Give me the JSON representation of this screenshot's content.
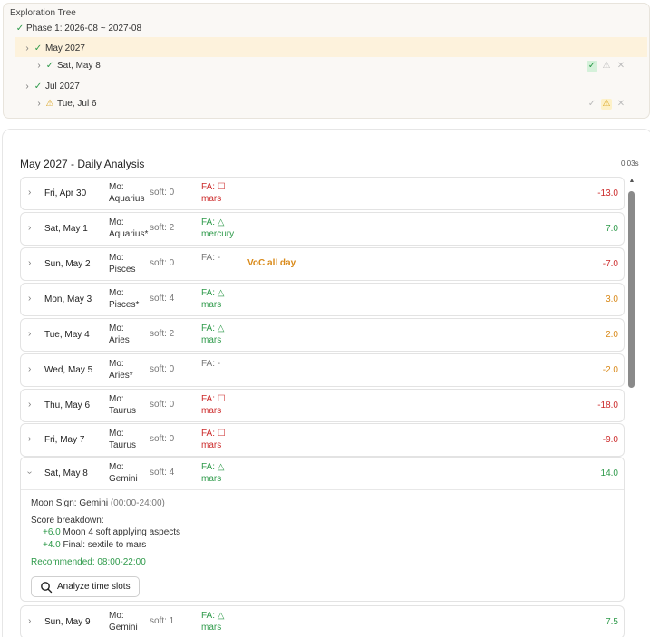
{
  "tree": {
    "title": "Exploration Tree",
    "phase": "Phase 1: 2026-08 ~ 2027-08",
    "month1": "May 2027",
    "day1": "Sat, May 8",
    "month2": "Jul 2027",
    "day2": "Tue, Jul 6"
  },
  "panel": {
    "title": "May 2027 - Daily Analysis",
    "timing": "0.03s"
  },
  "days": [
    {
      "date": "Fri, Apr 30",
      "mo": "Mo:",
      "sign": "Aquarius",
      "soft": "soft: 0",
      "fa": "FA: ☐",
      "planet": "mars",
      "fa_color": "red",
      "score": "-13.0",
      "score_color": "red"
    },
    {
      "date": "Sat, May 1",
      "mo": "Mo:",
      "sign": "Aquarius*",
      "soft": "soft: 2",
      "fa": "FA: △",
      "planet": "mercury",
      "fa_color": "green",
      "score": "7.0",
      "score_color": "green"
    },
    {
      "date": "Sun, May 2",
      "mo": "Mo:",
      "sign": "Pisces",
      "soft": "soft: 0",
      "fa": "FA: -",
      "planet": "",
      "fa_color": "gray",
      "voc": "VoC all day",
      "score": "-7.0",
      "score_color": "red"
    },
    {
      "date": "Mon, May 3",
      "mo": "Mo:",
      "sign": "Pisces*",
      "soft": "soft: 4",
      "fa": "FA: △",
      "planet": "mars",
      "fa_color": "green",
      "score": "3.0",
      "score_color": "orange"
    },
    {
      "date": "Tue, May 4",
      "mo": "Mo:",
      "sign": "Aries",
      "soft": "soft: 2",
      "fa": "FA: △",
      "planet": "mars",
      "fa_color": "green",
      "score": "2.0",
      "score_color": "orange"
    },
    {
      "date": "Wed, May 5",
      "mo": "Mo:",
      "sign": "Aries*",
      "soft": "soft: 0",
      "fa": "FA: -",
      "planet": "",
      "fa_color": "gray",
      "score": "-2.0",
      "score_color": "orange"
    },
    {
      "date": "Thu, May 6",
      "mo": "Mo:",
      "sign": "Taurus",
      "soft": "soft: 0",
      "fa": "FA: ☐",
      "planet": "mars",
      "fa_color": "red",
      "score": "-18.0",
      "score_color": "red"
    },
    {
      "date": "Fri, May 7",
      "mo": "Mo:",
      "sign": "Taurus",
      "soft": "soft: 0",
      "fa": "FA: ☐",
      "planet": "mars",
      "fa_color": "red",
      "score": "-9.0",
      "score_color": "red"
    }
  ],
  "expanded": {
    "date": "Sat, May 8",
    "mo": "Mo:",
    "sign": "Gemini",
    "soft": "soft: 4",
    "fa": "FA: △",
    "planet": "mars",
    "score": "14.0",
    "moon_sign_label": "Moon Sign: Gemini",
    "moon_sign_time": "(00:00-24:00)",
    "breakdown_label": "Score breakdown:",
    "b1_val": "+6.0",
    "b1_text": "Moon 4 soft applying aspects",
    "b2_val": "+4.0",
    "b2_text": "Final: sextile to mars",
    "recommended_label": "Recommended:",
    "recommended_value": "08:00-22:00",
    "button_label": "Analyze time slots"
  },
  "last_day": {
    "date": "Sun, May 9",
    "mo": "Mo:",
    "sign": "Gemini",
    "soft": "soft: 1",
    "fa": "FA: △",
    "planet": "mars",
    "score": "7.5"
  },
  "colors": {
    "accent_green": "#2e9a4a",
    "accent_red": "#cc2a2a",
    "accent_orange": "#d98a1a",
    "highlight": "#fdf2dc"
  }
}
